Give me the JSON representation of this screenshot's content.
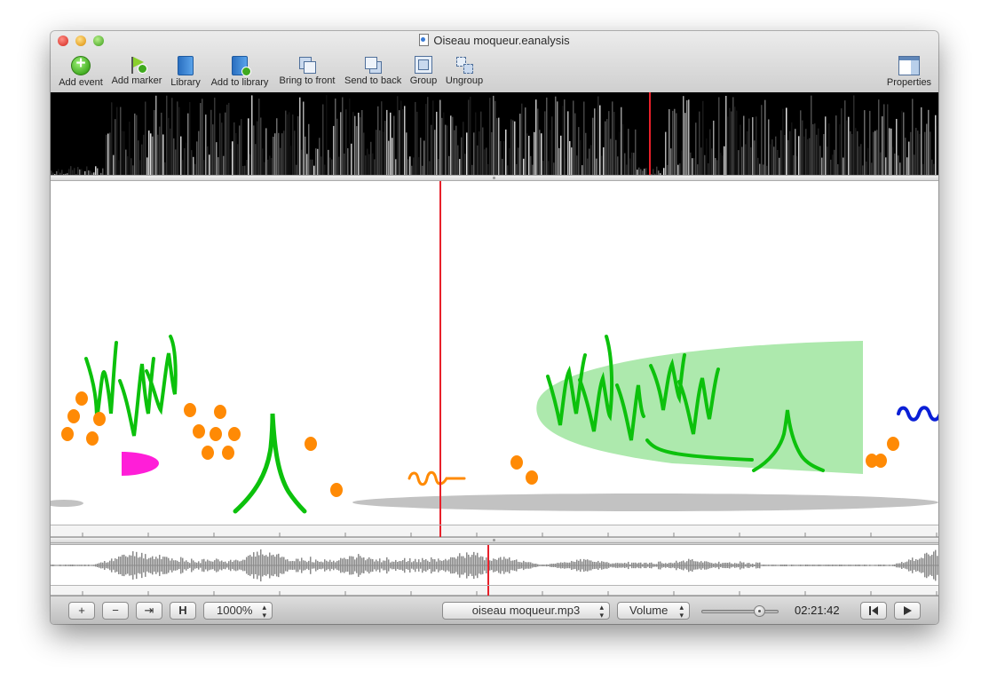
{
  "window": {
    "title": "Oiseau moqueur.eanalysis"
  },
  "toolbar": {
    "add_event": "Add event",
    "add_marker": "Add marker",
    "library": "Library",
    "add_to_library": "Add to library",
    "bring_to_front": "Bring to front",
    "send_to_back": "Send to back",
    "group": "Group",
    "ungroup": "Ungroup",
    "properties": "Properties"
  },
  "bottombar": {
    "zoom_in": "+",
    "zoom_out": "−",
    "fit": "⇥",
    "h_button": "H",
    "zoom_value": "1000%",
    "audio_file": "oiseau moqueur.mp3",
    "volume_label": "Volume",
    "volume_level": 0.75,
    "time": "02:21:42",
    "rewind_icon": "skip-to-start",
    "play_icon": "play"
  },
  "colors": {
    "playhead": "#e8202a",
    "green_shape": "#0cc10c",
    "green_fill": "#ade9ad",
    "orange": "#ff8a05",
    "magenta": "#ff1ed8",
    "blue": "#0a1fd6",
    "gray_band": "#c2c2c2"
  }
}
